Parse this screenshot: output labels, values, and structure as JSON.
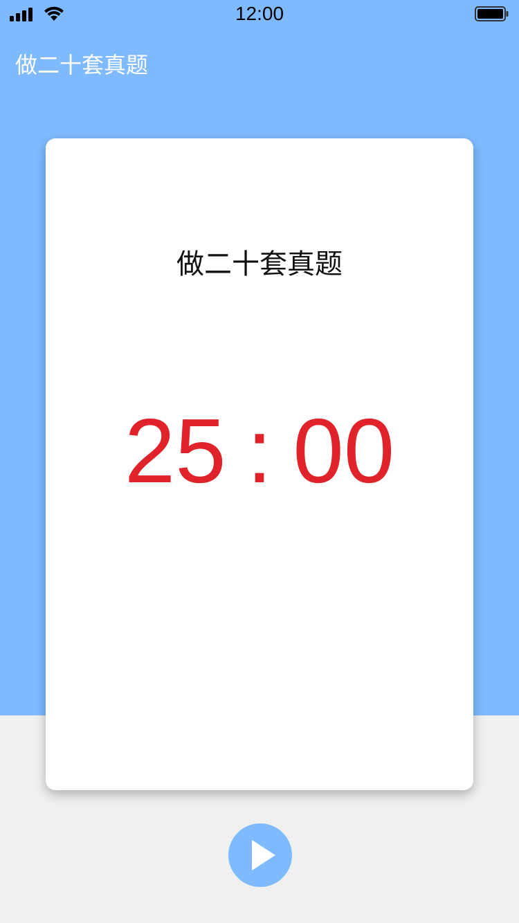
{
  "status_bar": {
    "time": "12:00",
    "signal_icon": "cellular-signal-icon",
    "wifi_icon": "wifi-icon",
    "battery_icon": "battery-icon",
    "battery_level": 1.0
  },
  "nav": {
    "title": "做二十套真题"
  },
  "task_card": {
    "task_name": "做二十套真题",
    "timer": {
      "minutes": "25",
      "separator": ":",
      "seconds": "00"
    }
  },
  "controls": {
    "play_icon": "play-icon"
  },
  "colors": {
    "header_background": "#7fbaff",
    "page_background": "#f0f0f0",
    "timer_text": "#e0222a",
    "play_button": "#7fbaff"
  }
}
